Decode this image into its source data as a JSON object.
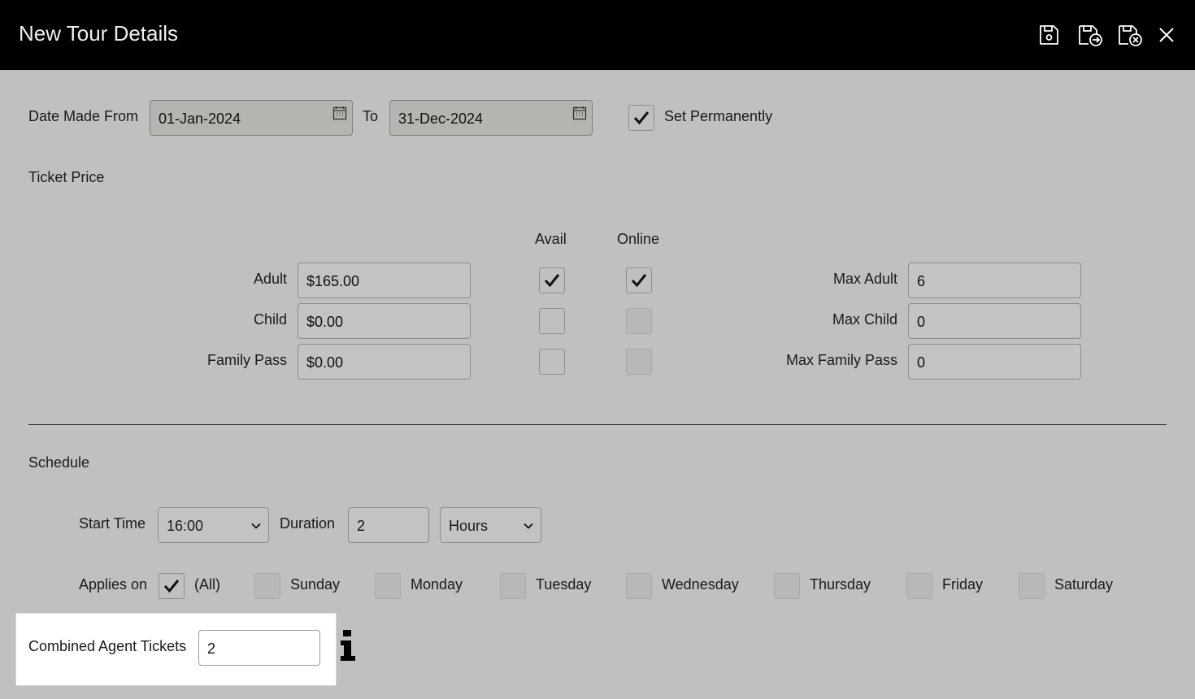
{
  "window": {
    "title": "New Tour Details",
    "toolbar_icons": [
      "save-icon",
      "save-and-new-icon",
      "save-and-close-icon",
      "close-icon"
    ]
  },
  "date_range": {
    "from_label": "Date Made From",
    "from_value": "01-Jan-2024",
    "to_label": "To",
    "to_value": "31-Dec-2024",
    "set_permanently_label": "Set Permanently",
    "set_permanently_checked": true
  },
  "ticket_price": {
    "section_title": "Ticket Price",
    "col_avail": "Avail",
    "col_online": "Online",
    "rows": [
      {
        "label": "Adult",
        "price": "$165.00",
        "avail": true,
        "online": true,
        "max_label": "Max Adult",
        "max_value": "6"
      },
      {
        "label": "Child",
        "price": "$0.00",
        "avail": false,
        "online": false,
        "max_label": "Max Child",
        "max_value": "0"
      },
      {
        "label": "Family Pass",
        "price": "$0.00",
        "avail": false,
        "online": false,
        "max_label": "Max Family Pass",
        "max_value": "0"
      }
    ]
  },
  "schedule": {
    "section_title": "Schedule",
    "start_time_label": "Start Time",
    "start_time_value": "16:00",
    "duration_label": "Duration",
    "duration_value": "2",
    "duration_unit": "Hours",
    "applies_on_label": "Applies on",
    "days": [
      {
        "label": "(All)",
        "checked": true
      },
      {
        "label": "Sunday",
        "checked": false
      },
      {
        "label": "Monday",
        "checked": false
      },
      {
        "label": "Tuesday",
        "checked": false
      },
      {
        "label": "Wednesday",
        "checked": false
      },
      {
        "label": "Thursday",
        "checked": false
      },
      {
        "label": "Friday",
        "checked": false
      },
      {
        "label": "Saturday",
        "checked": false
      }
    ]
  },
  "combined_agent": {
    "label": "Combined Agent Tickets",
    "value": "2"
  },
  "colors": {
    "titlebar": "#000000",
    "background": "#c0c0c0",
    "highlight_panel": "#ffffff"
  }
}
